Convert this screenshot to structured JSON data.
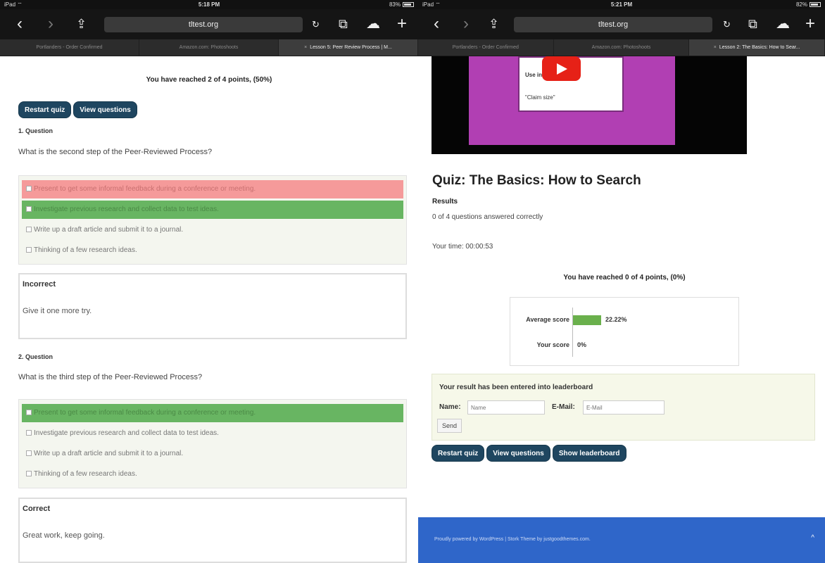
{
  "left": {
    "status": {
      "carrier": "iPad ⌔",
      "time": "5:18 PM",
      "battery": "83%"
    },
    "toolbar": {
      "url": "tltest.org",
      "back": "‹",
      "forward": "›",
      "share": "⇪",
      "reload": "↻",
      "tabs_icon": "⧉",
      "cloud": "☁",
      "new_tab": "+"
    },
    "tabs": [
      "Portlanders - Order Confirmed",
      "Amazon.com: Photoshoots",
      "Lesson 5: Peer Review Process | M..."
    ],
    "points": "You have reached 2 of 4 points, (50%)",
    "buttons": {
      "restart": "Restart quiz",
      "view": "View questions"
    },
    "q1": {
      "title": "1. Question",
      "text": "What is the second step of the Peer-Reviewed Process?",
      "answers": [
        "Present to get some informal feedback during a conference or meeting.",
        "Investigate previous research and collect data to test ideas.",
        "Write up a draft article and submit it to a journal.",
        "Thinking of a few research ideas."
      ],
      "feedback_title": "Incorrect",
      "feedback_text": "Give it one more try."
    },
    "q2": {
      "title": "2. Question",
      "text": "What is the third step of the Peer-Reviewed Process?",
      "answers": [
        "Present to get some informal feedback during a conference or meeting.",
        "Investigate previous research and collect data to test ideas.",
        "Write up a draft article and submit it to a journal.",
        "Thinking of a few research ideas."
      ],
      "feedback_title": "Correct",
      "feedback_text": "Great work, keep going."
    }
  },
  "right": {
    "status": {
      "carrier": "iPad ⌔",
      "time": "5:21 PM",
      "battery": "82%"
    },
    "toolbar": {
      "url": "tltest.org",
      "back": "‹",
      "forward": "›",
      "share": "⇪",
      "reload": "↻",
      "tabs_icon": "⧉",
      "cloud": "☁",
      "new_tab": "+"
    },
    "tabs": [
      "Portlanders - Order Confirmed",
      "Amazon.com: Photoshoots",
      "Lesson 2: The Basics: How to Sear..."
    ],
    "video_lines": [
      "Use instead of",
      "\"Claim size\""
    ],
    "quiz_title": "Quiz: The Basics: How to Search",
    "results_heading": "Results",
    "results_text": "0 of 4 questions answered correctly",
    "time": "Your time: 00:00:53",
    "points": "You have reached 0 of 4 points, (0%)",
    "scores": {
      "average_label": "Average score",
      "average_value": "22.22%",
      "average_fraction": 0.2222,
      "your_label": "Your score",
      "your_value": "0%",
      "your_fraction": 0
    },
    "leaderboard": {
      "heading": "Your result has been entered into leaderboard",
      "name_label": "Name:",
      "name_placeholder": "Name",
      "email_label": "E-Mail:",
      "email_placeholder": "E-Mail",
      "send": "Send"
    },
    "buttons": {
      "restart": "Restart quiz",
      "view": "View questions",
      "leaderboard": "Show leaderboard"
    },
    "footer": {
      "text": "Proudly powered by WordPress | Stork Theme by justgoodthemes.com.",
      "scroll_top": "^"
    }
  },
  "colors": {
    "button_bg": "#1f4660",
    "incorrect": "#f59a9a",
    "correct": "#68b562",
    "footer_bg": "#2f66c9",
    "score_bar": "#6ab04c"
  }
}
